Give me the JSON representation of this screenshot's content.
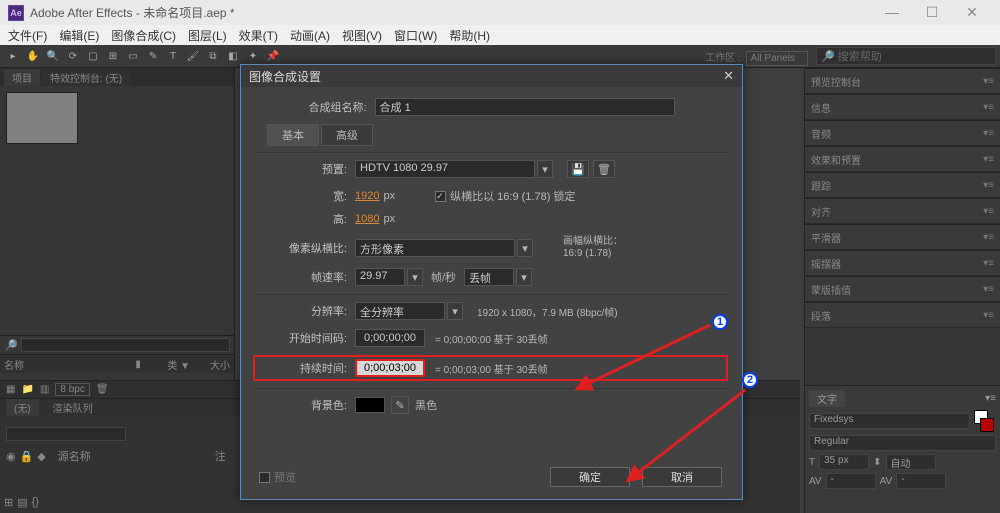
{
  "window": {
    "app": "Adobe After Effects",
    "title": "未命名项目.aep *"
  },
  "menu": [
    "文件(F)",
    "编辑(E)",
    "图像合成(C)",
    "图层(L)",
    "效果(T)",
    "动画(A)",
    "视图(V)",
    "窗口(W)",
    "帮助(H)"
  ],
  "workspace": {
    "label": "工作区 :",
    "value": "All Panels"
  },
  "search_placeholder": "搜索帮助",
  "left_tabs": {
    "project": "项目",
    "fx": "特效控制台: (无)"
  },
  "list_headers": {
    "name": "名称",
    "type": "类 ▼",
    "size": "大小"
  },
  "bottombar": {
    "bpc": "8 bpc"
  },
  "timeline_tabs": {
    "none": "(无)",
    "render": "渲染队列"
  },
  "source_label": "源名称",
  "note_label": "注",
  "dialog": {
    "title": "图像合成设置",
    "comp_name_label": "合成组名称:",
    "comp_name": "合成 1",
    "tab_basic": "基本",
    "tab_advanced": "高级",
    "preset_label": "预置:",
    "preset_value": "HDTV 1080 29.97",
    "width_label": "宽:",
    "width_value": "1920",
    "height_label": "高:",
    "height_value": "1080",
    "px": "px",
    "lock_aspect": "纵横比以 16:9 (1.78) 锁定",
    "par_label": "像素纵横比:",
    "par_value": "方形像素",
    "par_info1": "画幅纵横比：",
    "par_info2": "16:9 (1.78)",
    "fps_label": "帧速率:",
    "fps_value": "29.97",
    "fps_unit": "帧/秒",
    "fps_drop": "丢帧",
    "res_label": "分辨率:",
    "res_value": "全分辨率",
    "res_info": "1920 x 1080，7.9 MB (8bpc/帧)",
    "start_label": "开始时间码:",
    "start_value": "0;00;00;00",
    "start_info": "= 0;00;00;00 基于 30丢帧",
    "dur_label": "持续时间:",
    "dur_value": "0;00;03;00",
    "dur_info": "= 0;00;03;00 基于 30丢帧",
    "bg_label": "背景色:",
    "bg_name": "黑色",
    "preview_cb": "预览",
    "ok": "确定",
    "cancel": "取消"
  },
  "rpanels": [
    "预览控制台",
    "信息",
    "音频",
    "效果和预置",
    "跟踪",
    "对齐",
    "平滑器",
    "摇摆器",
    "蒙版插值",
    "段落"
  ],
  "char": {
    "tab": "文字",
    "font": "Fixedsys",
    "style": "Regular",
    "size": "35 px",
    "leading": "自动"
  },
  "annotations": {
    "one": "1",
    "two": "2"
  }
}
